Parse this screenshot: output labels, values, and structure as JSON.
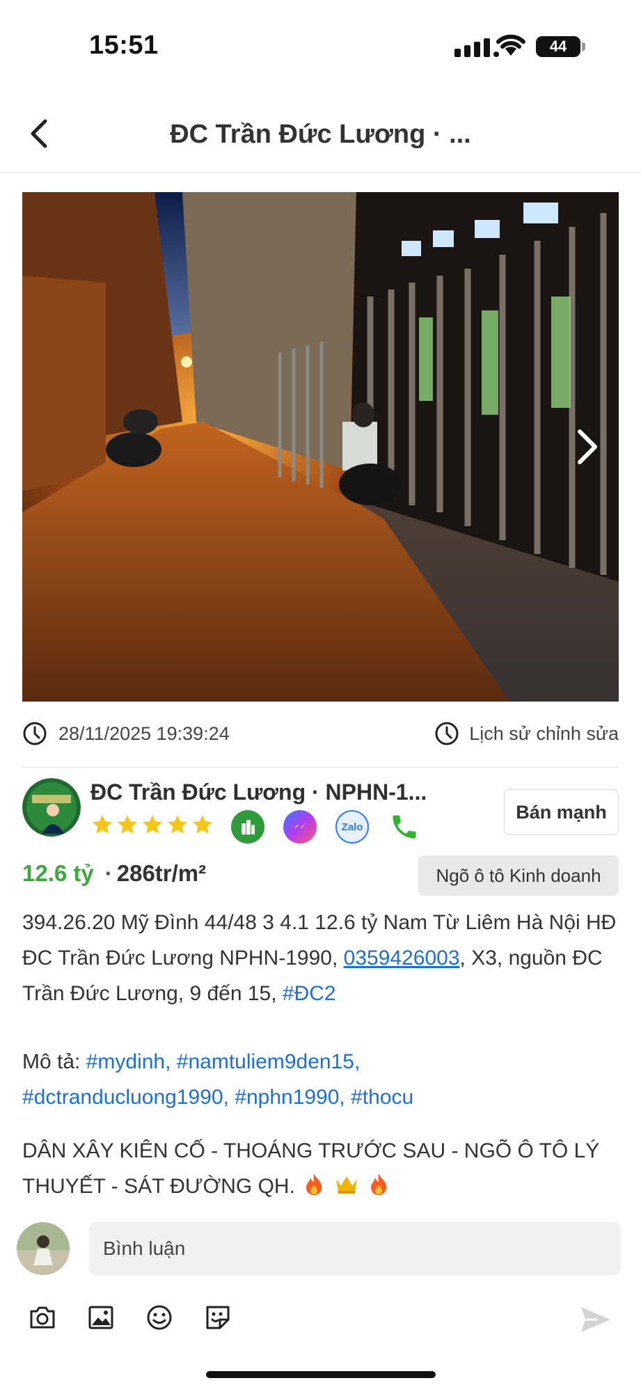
{
  "status_bar": {
    "time": "15:51",
    "battery": "44",
    "icons": [
      "signal-icon",
      "wifi-icon",
      "battery-icon"
    ]
  },
  "header": {
    "title": "ĐC Trần Đức Lương · ...",
    "back_icon": "chevron-left-icon"
  },
  "photo": {
    "next_icon": "chevron-right-icon"
  },
  "meta": {
    "timestamp": "28/11/2025 19:39:24",
    "history_label": "Lịch sử chỉnh sửa",
    "icons": [
      "clock-icon",
      "clock-icon"
    ]
  },
  "author": {
    "name": "ĐC Trần Đức Lương · NPHN-1...",
    "rating": 5,
    "rating_max": 5,
    "contacts": [
      "app-icon",
      "messenger-icon",
      "zalo-icon",
      "phone-icon"
    ],
    "zalo_label": "Zalo",
    "sell_button": "Bán mạnh"
  },
  "listing": {
    "price": "12.6 tỷ",
    "separator": "·",
    "price_per_m2": "286tr/m²",
    "tag": "Ngõ ô tô Kinh doanh",
    "desc_part1": "394.26.20 Mỹ Đình 44/48 3 4.1 12.6 tỷ Nam Từ Liêm Hà Nội HĐ ĐC Trần Đức Lương NPHN-1990, ",
    "phone": "0359426003",
    "desc_part2": ", X3, nguồn ĐC Trần Đức Lương, 9 đến 15, ",
    "code_tag": "#ĐC2",
    "tags_label": "Mô tả: ",
    "tags": [
      "#mydinh,",
      "#namtuliem9den15,",
      "#dctranducluong1990,",
      "#nphn1990,",
      "#thocu"
    ],
    "caption": "DÂN XÂY KIÊN CỐ - THOÁNG TRƯỚC SAU - NGÕ Ô TÔ LÝ THUYẾT - SÁT ĐƯỜNG QH."
  },
  "comment": {
    "placeholder": "Bình luận",
    "toolbar_icons": [
      "camera-icon",
      "image-icon",
      "smiley-icon",
      "sticker-icon"
    ],
    "send_icon": "send-icon"
  },
  "colors": {
    "price": "#3fa63f",
    "link": "#1e6ed8",
    "star": "#f5c518",
    "phone_icon": "#34b233"
  }
}
